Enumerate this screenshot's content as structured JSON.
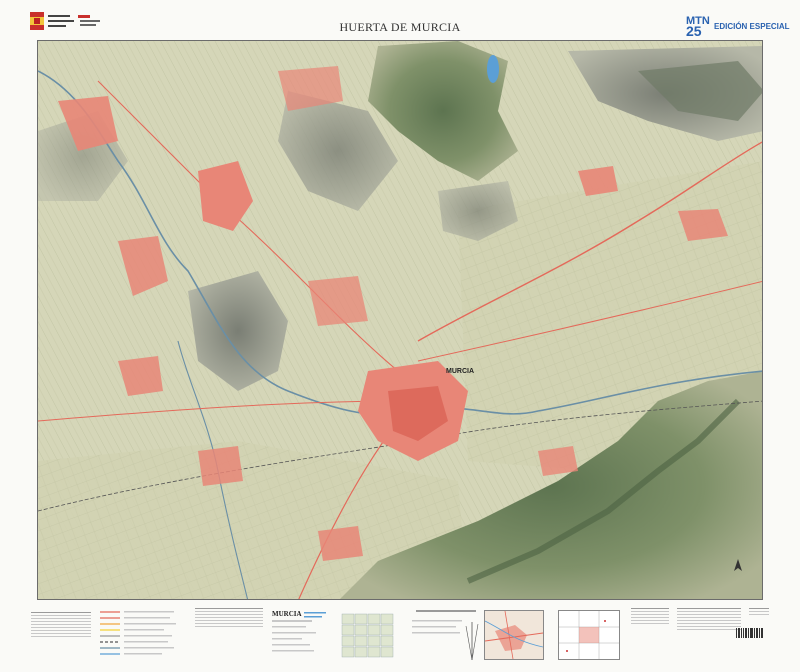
{
  "header": {
    "title": "HUERTA DE MURCIA",
    "series_prefix": "MTN",
    "series_number": "25",
    "edition": "EDICIÓN ESPECIAL"
  },
  "map": {
    "city_label": "MURCIA",
    "icons": {
      "logo": "government-logo-icon",
      "north": "north-arrow-icon"
    },
    "colors": {
      "plain": "#d9d6bb",
      "farmland": "#cfd3b0",
      "mountain": "#7e8f6b",
      "mountain_dark": "#5e7450",
      "urban": "#e88677",
      "urban_core": "#dd6a5c",
      "water": "#5b9fd6",
      "road": "#e4695a",
      "river": "#6a8fa6",
      "frame": "#6b6b6b",
      "series_blue": "#2a62b0"
    }
  },
  "legend": {
    "heading": "MURCIA"
  }
}
